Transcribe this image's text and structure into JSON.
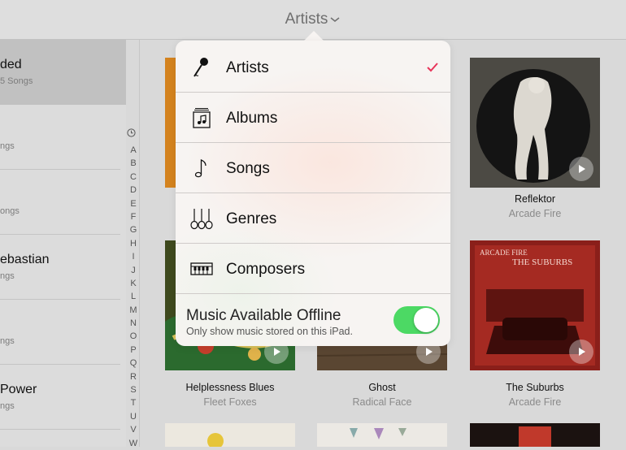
{
  "topbar": {
    "title": "Artists"
  },
  "sidebar": {
    "artists": [
      {
        "name": "ded",
        "sub": "5 Songs"
      },
      {
        "name": "",
        "sub": "ngs"
      },
      {
        "name": "",
        "sub": "ongs"
      },
      {
        "name": "ebastian",
        "sub": "ngs"
      },
      {
        "name": "",
        "sub": "ngs"
      },
      {
        "name": "Power",
        "sub": "ngs"
      }
    ],
    "index_letters": [
      "A",
      "B",
      "C",
      "D",
      "E",
      "F",
      "G",
      "H",
      "I",
      "J",
      "K",
      "L",
      "M",
      "N",
      "O",
      "P",
      "Q",
      "R",
      "S",
      "T",
      "U",
      "V",
      "W"
    ]
  },
  "albums": [
    {
      "title": "Reflektor",
      "artist": "Arcade Fire"
    },
    {
      "title": "Helplessness Blues",
      "artist": "Fleet Foxes"
    },
    {
      "title": "Ghost",
      "artist": "Radical Face"
    },
    {
      "title": "The Suburbs",
      "artist": "Arcade Fire",
      "cover_text": "ARCADE FIRE THE SUBURBS"
    }
  ],
  "popover": {
    "items": [
      {
        "label": "Artists",
        "icon": "microphone-icon",
        "checked": true
      },
      {
        "label": "Albums",
        "icon": "album-icon",
        "checked": false
      },
      {
        "label": "Songs",
        "icon": "music-note-icon",
        "checked": false
      },
      {
        "label": "Genres",
        "icon": "guitars-icon",
        "checked": false
      },
      {
        "label": "Composers",
        "icon": "piano-icon",
        "checked": false
      }
    ],
    "offline": {
      "title": "Music Available Offline",
      "subtitle": "Only show music stored on this iPad.",
      "enabled": true
    }
  },
  "colors": {
    "accent": "#e8345a",
    "toggle_on": "#4cd964",
    "background": "#d9d9d9"
  }
}
